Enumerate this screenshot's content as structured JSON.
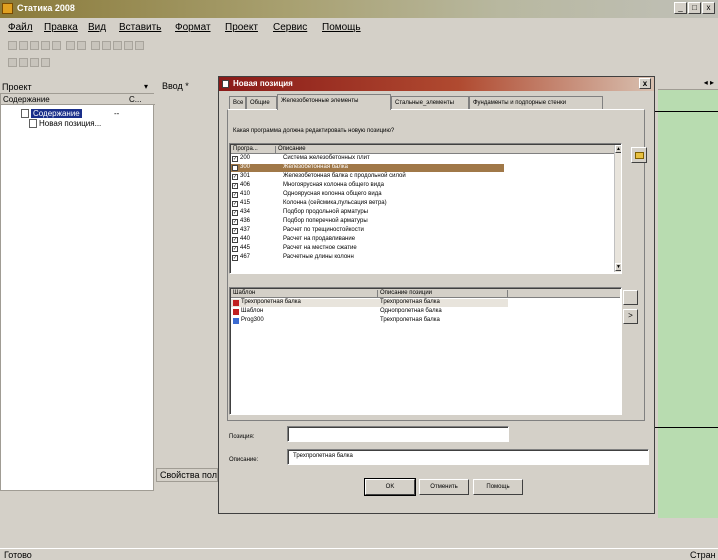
{
  "window": {
    "title": "Статика 2008",
    "buttons": [
      "_",
      "□",
      "x"
    ]
  },
  "menu": [
    {
      "label": "Файл"
    },
    {
      "label": "Правка"
    },
    {
      "label": "Вид"
    },
    {
      "label": "Вставить"
    },
    {
      "label": "Формат"
    },
    {
      "label": "Проект"
    },
    {
      "label": "Сервис"
    },
    {
      "label": "Помощь"
    }
  ],
  "left_panel": {
    "header": "Проект",
    "pin": "▾",
    "columns": [
      "Содержание",
      "C..."
    ],
    "nodes": [
      {
        "label": "Содержание",
        "extra": "--"
      },
      {
        "label": "Новая позиция..."
      }
    ]
  },
  "input_tab": "Ввод *",
  "right_strip": "◂ ▸",
  "properties_tab": "Свойства пол",
  "statusbar": {
    "left": "Готово",
    "right": "Стран"
  },
  "dialog": {
    "title": "Новая позиция",
    "close": "x",
    "tabs": [
      {
        "label": "Все"
      },
      {
        "label": "Общие"
      },
      {
        "label": "Железобетонные элементы"
      },
      {
        "label": "Стальные_элементы"
      },
      {
        "label": "Фундаменты и подпорные стенки"
      }
    ],
    "active_tab": 2,
    "question": "Какая программа должна редактировать новую позицию?",
    "program_list": {
      "headers": [
        "Програ...",
        "Описание"
      ],
      "rows": [
        {
          "code": "200",
          "desc": "Система железобетонных плит",
          "checked": true
        },
        {
          "code": "300",
          "desc": "Железобетонная балка",
          "checked": true,
          "selected": true
        },
        {
          "code": "301",
          "desc": "Железобетонная балка с продольной силой",
          "checked": true
        },
        {
          "code": "406",
          "desc": "Многоярусная колонна общего вида",
          "checked": true
        },
        {
          "code": "410",
          "desc": "Одноярусная колонна общего вида",
          "checked": true
        },
        {
          "code": "415",
          "desc": "Колонна (сейсмика,пульсация ветра)",
          "checked": true
        },
        {
          "code": "434",
          "desc": "Подбор продольной арматуры",
          "checked": true
        },
        {
          "code": "436",
          "desc": "Подбор поперечной арматуры",
          "checked": true
        },
        {
          "code": "437",
          "desc": "Расчет по трещиностойкости",
          "checked": true
        },
        {
          "code": "440",
          "desc": "Расчет на продавливание",
          "checked": true
        },
        {
          "code": "445",
          "desc": "Расчет на местное сжатие",
          "checked": true
        },
        {
          "code": "467",
          "desc": "Расчетные длины колонн",
          "checked": true
        }
      ]
    },
    "template_list": {
      "headers": [
        "Шаблон",
        "Описание позиции"
      ],
      "rows": [
        {
          "name": "Трехпролетная балка",
          "desc": "Трехпролетная балка",
          "icon": "template-red-icon"
        },
        {
          "name": "Шаблон",
          "desc": "Однопролетная балка",
          "icon": "template-red-icon"
        },
        {
          "name": "Prog300",
          "desc": "Трехпролетная балка",
          "icon": "program-blue-icon"
        }
      ]
    },
    "fields": {
      "position_label": "Позиция:",
      "position_value": "",
      "description_label": "Описание:",
      "description_value": "Трехпролетная балка"
    },
    "buttons": {
      "ok": "OK",
      "cancel": "Отменить",
      "help": "Помощь"
    }
  }
}
